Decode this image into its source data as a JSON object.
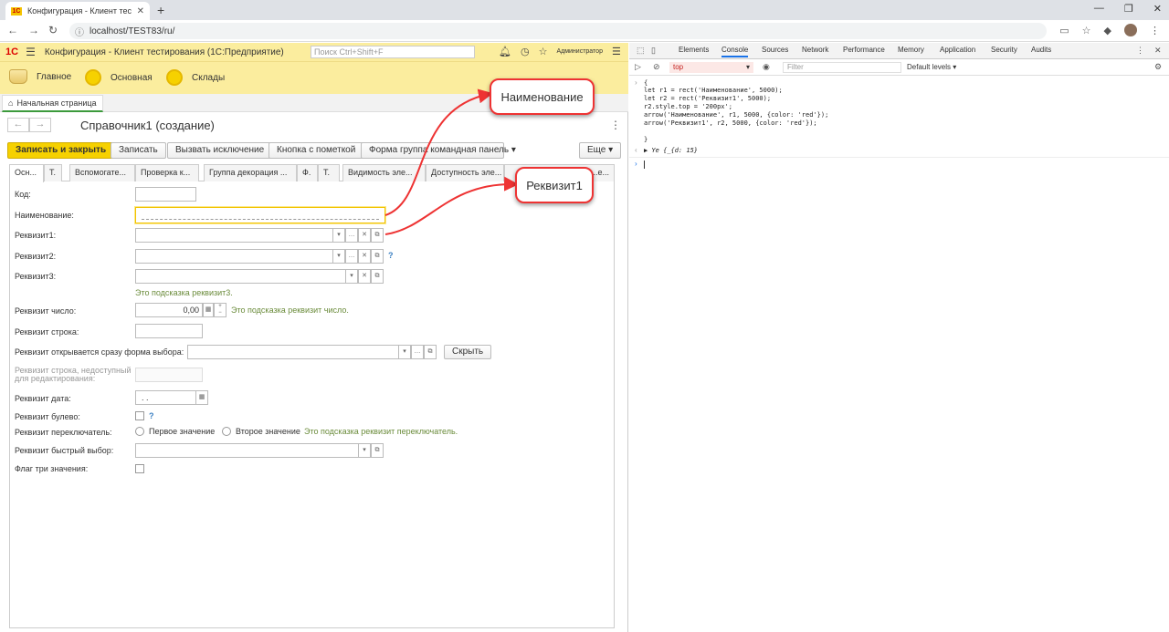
{
  "browser": {
    "tab_title": "Конфигурация - Клиент тестиро",
    "url": "localhost/TEST83/ru/"
  },
  "app": {
    "logo": "1С",
    "title": "Конфигурация  - Клиент тестирования (1С:Предприятие)",
    "search_placeholder": "Поиск Ctrl+Shift+F",
    "user": "Администратор",
    "sections": [
      "Главное",
      "Основная",
      "Склады"
    ],
    "home_tab": "Начальная страница"
  },
  "form": {
    "title": "Справочник1 (создание)",
    "buttons": [
      "Записать и закрыть",
      "Записать",
      "Вызвать исключение",
      "Кнопка с пометкой",
      "Форма группа командная панель",
      "Еще"
    ],
    "tabs": [
      "Осн...",
      "Т.",
      "Вспомогате...",
      "Проверка к...",
      "Группа декорация ...",
      "Ф.",
      "Т.",
      "Видимость эле...",
      "Доступность эле...",
      "...е..."
    ],
    "fields": {
      "code_label": "Код:",
      "name_label": "Наименование:",
      "req1_label": "Реквизит1:",
      "req2_label": "Реквизит2:",
      "req3_label": "Реквизит3:",
      "req3_hint": "Это подсказка реквизит3.",
      "num_label": "Реквизит число:",
      "num_value": "0,00",
      "num_hint": "Это подсказка реквизит число.",
      "str_label": "Реквизит строка:",
      "choice_label": "Реквизит открывается сразу форма выбора:",
      "hide_button": "Скрыть",
      "str_dis_label_1": "Реквизит строка, недоступный",
      "str_dis_label_2": "для редактирования:",
      "date_label": "Реквизит дата:",
      "date_value": " .  .",
      "bool_label": "Реквизит булево:",
      "switch_label": "Реквизит переключатель:",
      "switch_opt1": "Первое значение",
      "switch_opt2": "Второе значение",
      "switch_hint": "Это подсказка реквизит переключатель.",
      "quick_label": "Реквизит быстрый выбор:",
      "flag_label": "Флаг три значения:",
      "qmark": "?"
    }
  },
  "callouts": {
    "name": "Наименование",
    "req1": "Реквизит1"
  },
  "devtools": {
    "tabs": [
      "Elements",
      "Console",
      "Sources",
      "Network",
      "Performance",
      "Memory",
      "Application",
      "Security",
      "Audits"
    ],
    "context": "top",
    "filter_placeholder": "Filter",
    "levels": "Default levels",
    "lines": [
      "{",
      "let r1 = rect('Наименование', 5000);",
      "let r2 = rect('Реквизит1', 5000);",
      "r2.style.top = '200px';",
      "arrow('Наименование', r1, 5000, {color: 'red'});",
      "arrow('Реквизит1', r2, 5000, {color: 'red'});",
      "",
      "}",
      "▶ Ye {_{d: 15}"
    ]
  },
  "colors": {
    "accent_yellow": "#f6d100",
    "header_bg": "#fbed9e",
    "arrow_red": "#e33"
  }
}
